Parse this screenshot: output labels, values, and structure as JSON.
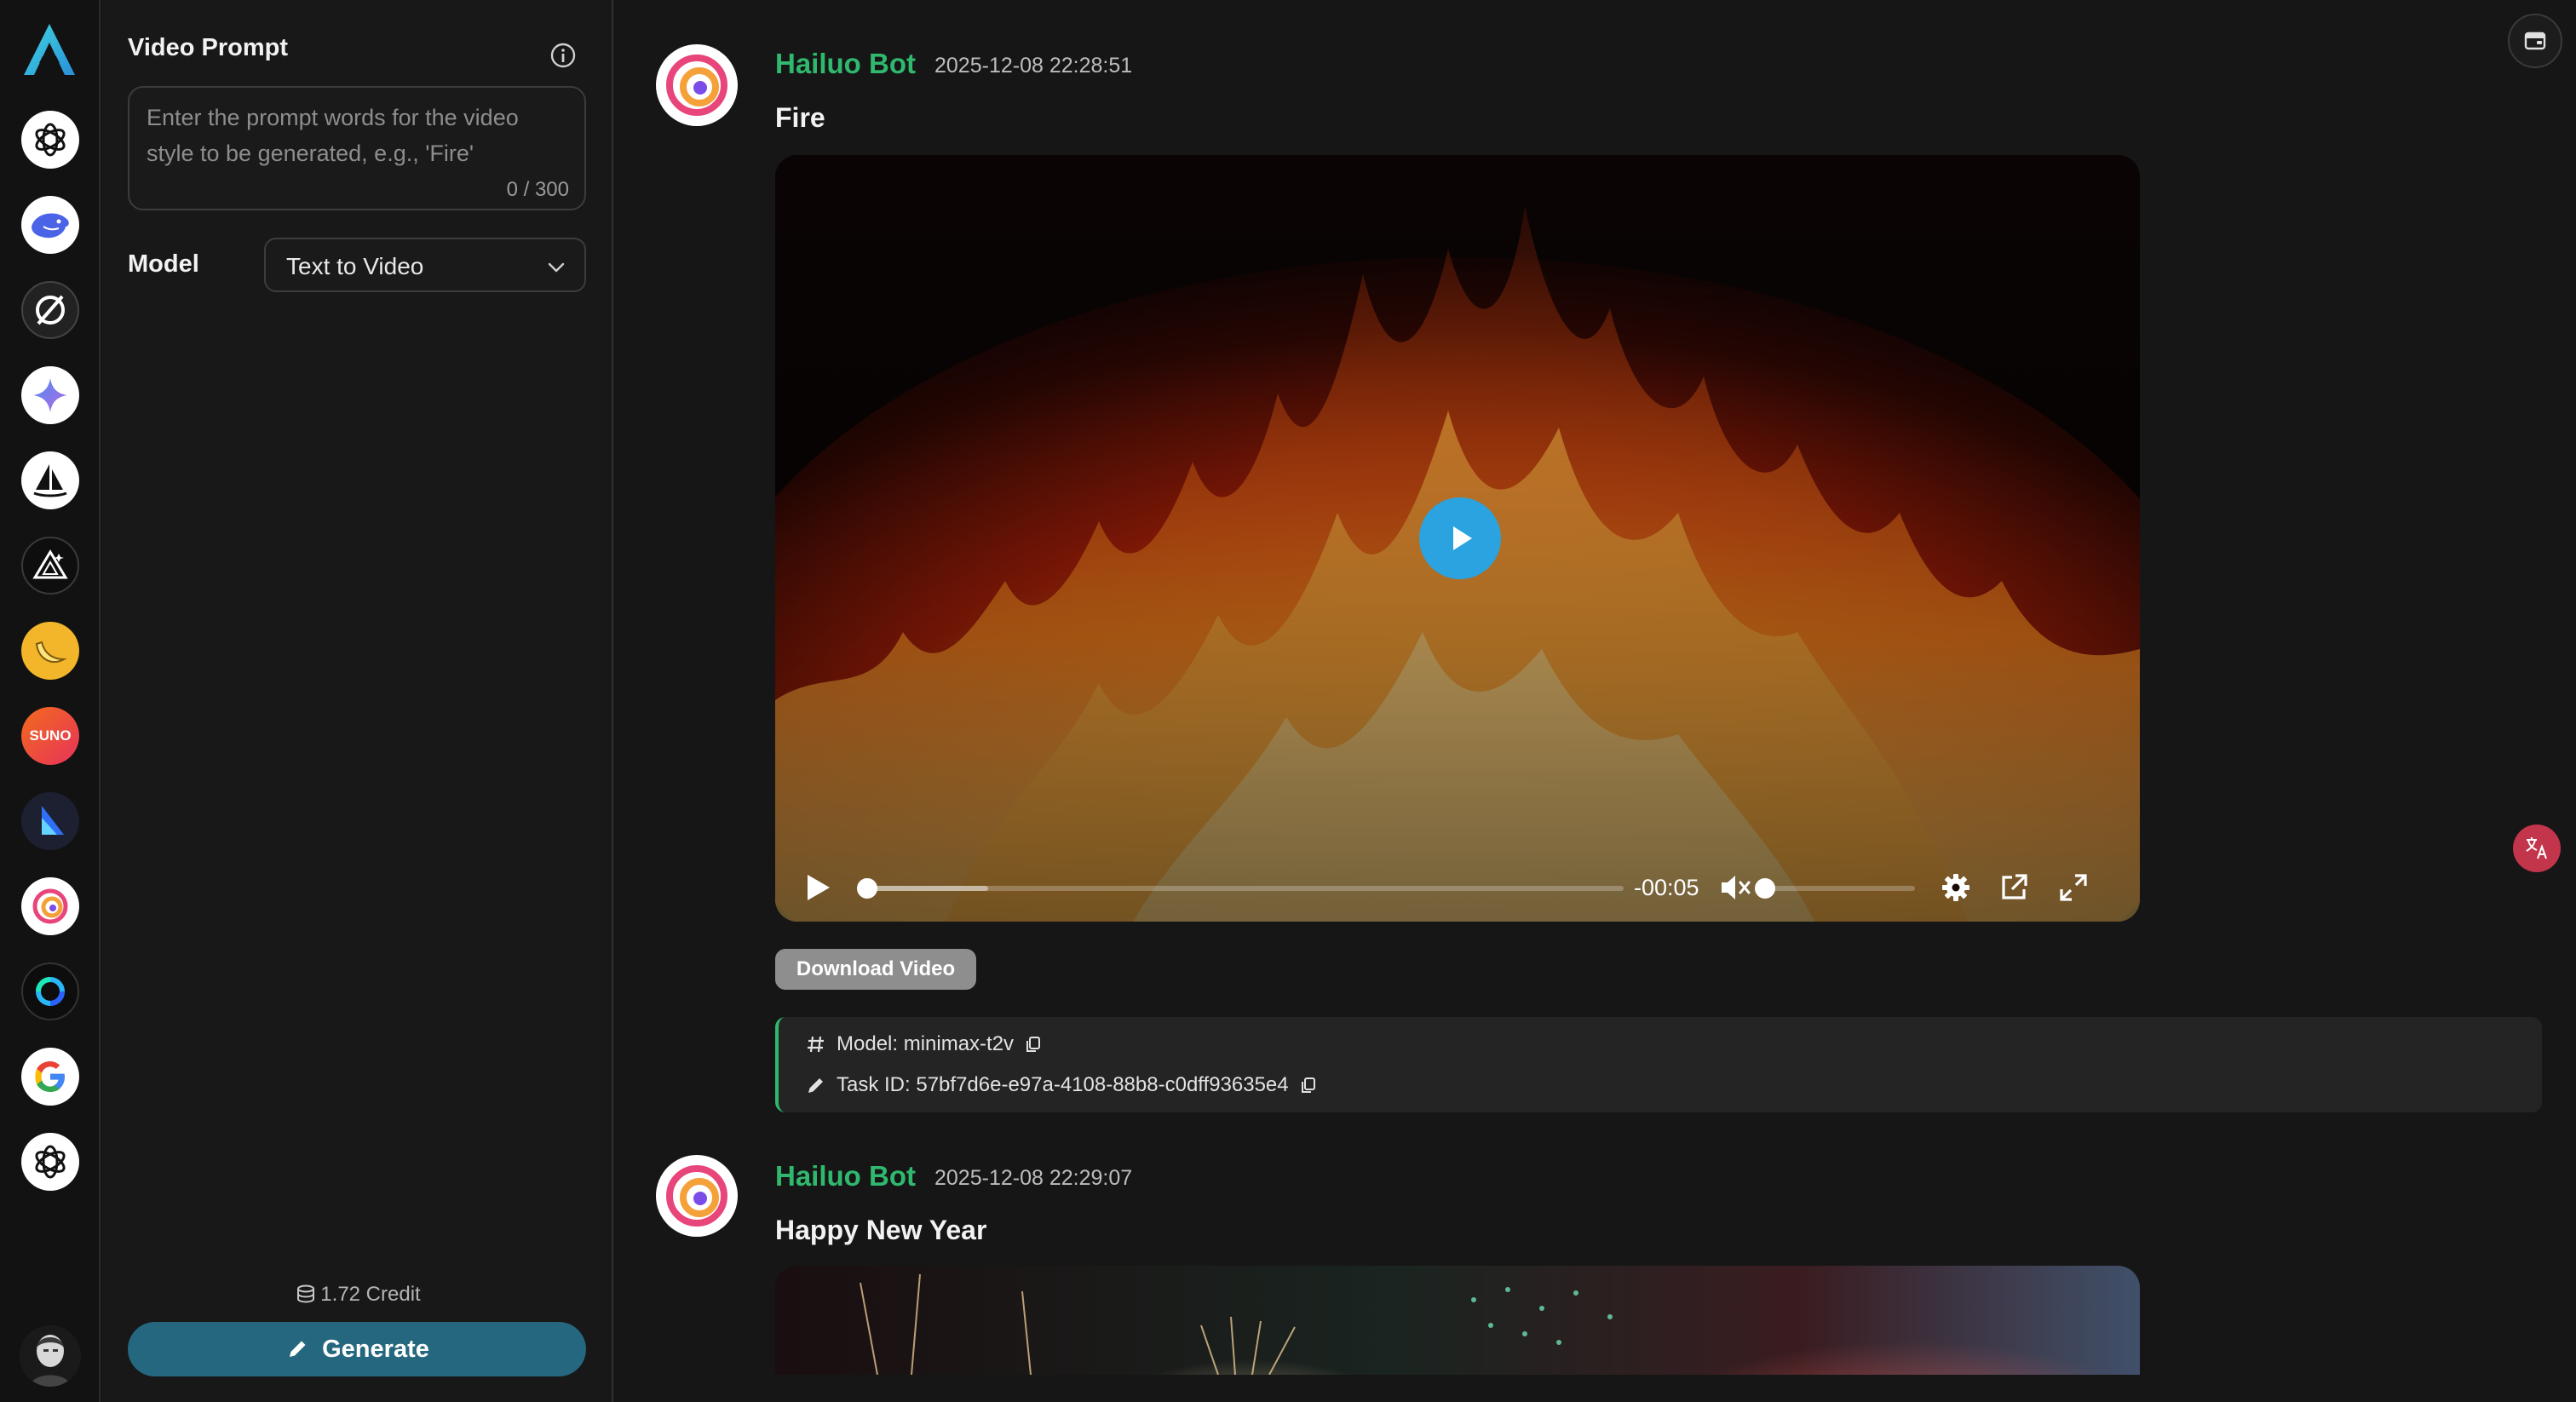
{
  "sidebar": {
    "items": [
      {
        "name": "chatgpt",
        "icon": "openai-icon"
      },
      {
        "name": "deepseek",
        "icon": "whale-icon"
      },
      {
        "name": "perplexity",
        "icon": "slashed-circle-icon"
      },
      {
        "name": "gemini",
        "icon": "sparkle-icon"
      },
      {
        "name": "midjourney",
        "icon": "sailboat-icon"
      },
      {
        "name": "stable-diffusion",
        "icon": "triangle-icon"
      },
      {
        "name": "nano-banana",
        "icon": "banana-icon"
      },
      {
        "name": "suno",
        "icon": "suno-icon",
        "label": "SUNO"
      },
      {
        "name": "luma",
        "icon": "luma-icon"
      },
      {
        "name": "hailuo",
        "icon": "hailuo-swirl-icon"
      },
      {
        "name": "kling",
        "icon": "ring-icon"
      },
      {
        "name": "google",
        "icon": "google-g-icon"
      },
      {
        "name": "openai",
        "icon": "openai-icon"
      }
    ]
  },
  "panel": {
    "title": "Video Prompt",
    "prompt": {
      "value": "",
      "placeholder": "Enter the prompt words for the video style to be generated, e.g., 'Fire'",
      "counter": "0 / 300"
    },
    "model_label": "Model",
    "model_value": "Text to Video",
    "credit": "1.72 Credit",
    "generate_label": "Generate"
  },
  "messages": [
    {
      "bot_name": "Hailuo Bot",
      "timestamp": "2025-12-08 22:28:51",
      "title": "Fire",
      "video": {
        "time_remaining": "-00:05",
        "progress": 0.0,
        "volume": 0.0,
        "muted": true
      },
      "download_label": "Download Video",
      "model_line": "Model: minimax-t2v",
      "task_line": "Task ID: 57bf7d6e-e97a-4108-88b8-c0dff93635e4"
    },
    {
      "bot_name": "Hailuo Bot",
      "timestamp": "2025-12-08 22:29:07",
      "title": "Happy New Year"
    }
  ],
  "colors": {
    "accent_green": "#2fb86e",
    "generate_button": "#25677f",
    "play_button": "#2aa3e0"
  }
}
